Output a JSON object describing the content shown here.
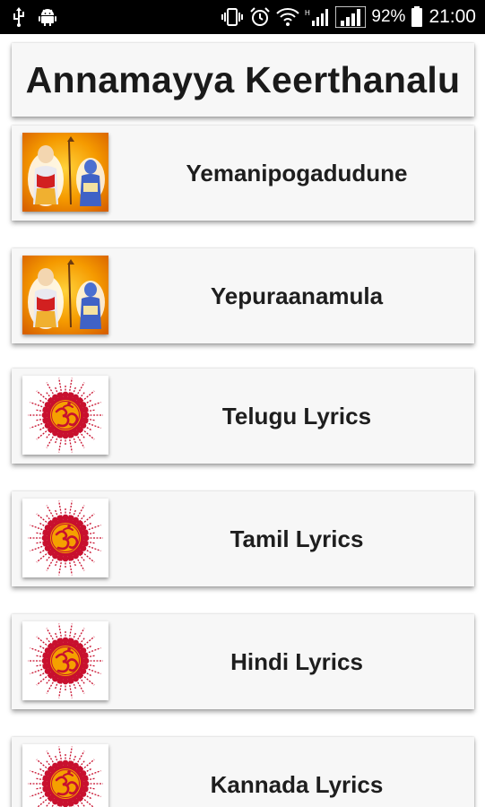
{
  "status_bar": {
    "battery_percent": "92%",
    "time": "21:00",
    "icons": [
      "usb-icon",
      "android-icon",
      "vibrate-icon",
      "alarm-icon",
      "wifi-icon",
      "signal-icon",
      "signal-icon",
      "battery-icon"
    ]
  },
  "app": {
    "title": "Annamayya Keerthanalu"
  },
  "items": [
    {
      "label": "Yemanipogadudune",
      "icon": "saint-image"
    },
    {
      "label": "Yepuraanamula",
      "icon": "saint-image"
    },
    {
      "label": "Telugu Lyrics",
      "icon": "om-sun-icon"
    },
    {
      "label": "Tamil Lyrics",
      "icon": "om-sun-icon"
    },
    {
      "label": "Hindi Lyrics",
      "icon": "om-sun-icon"
    },
    {
      "label": "Kannada Lyrics",
      "icon": "om-sun-icon"
    }
  ],
  "colors": {
    "status_bar_bg": "#000000",
    "card_bg": "#f7f7f7",
    "om_red": "#c8102e",
    "om_orange": "#f5a000",
    "saint_bg": "#f08a00"
  }
}
